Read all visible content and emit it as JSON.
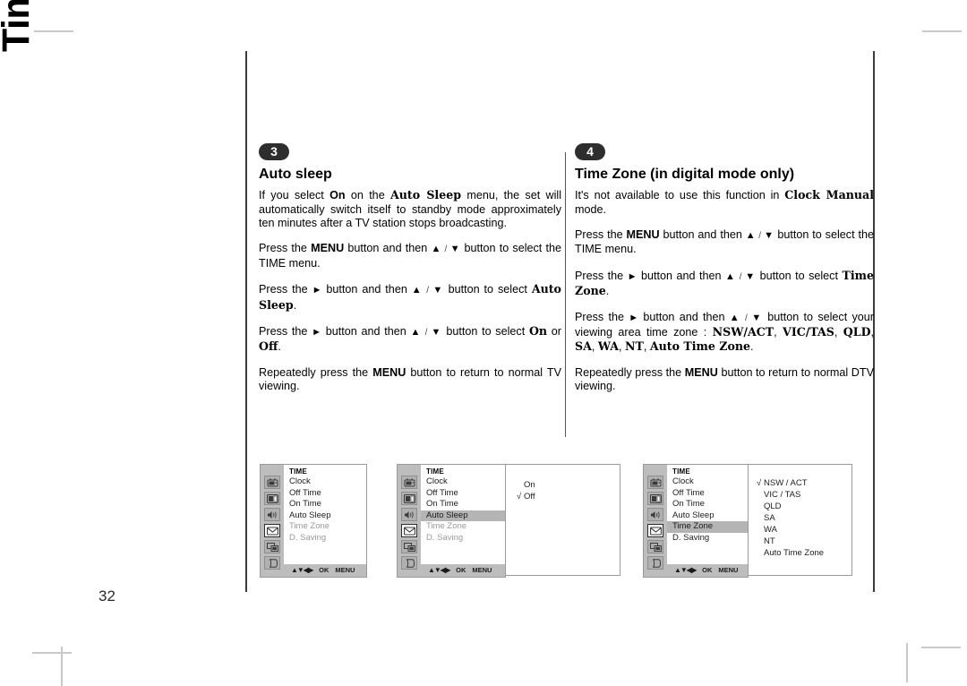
{
  "page": {
    "side_title": "Time Menu",
    "page_number": "32"
  },
  "sections": [
    {
      "badge": "3",
      "title": "Auto sleep",
      "paragraphs": [
        [
          {
            "t": "If you select ",
            "s": "n"
          },
          {
            "t": "On",
            "s": "b"
          },
          {
            "t": " on the ",
            "s": "n"
          },
          {
            "t": "Auto Sleep",
            "s": "slab"
          },
          {
            "t": " menu, the set will automatically switch itself to standby mode approximately ten minutes after a TV station stops broadcasting.",
            "s": "n"
          }
        ],
        [
          {
            "t": "Press the ",
            "s": "n"
          },
          {
            "t": "MENU",
            "s": "b"
          },
          {
            "t": " button and then ",
            "s": "n"
          },
          {
            "t": "▲",
            "s": "ar"
          },
          {
            "t": " / ",
            "s": "sl"
          },
          {
            "t": "▼",
            "s": "ar"
          },
          {
            "t": " button to select the TIME menu.",
            "s": "n"
          }
        ],
        [
          {
            "t": "Press the ",
            "s": "n"
          },
          {
            "t": "►",
            "s": "ar"
          },
          {
            "t": " button and then ",
            "s": "n"
          },
          {
            "t": "▲",
            "s": "ar"
          },
          {
            "t": " / ",
            "s": "sl"
          },
          {
            "t": "▼",
            "s": "ar"
          },
          {
            "t": " button to select ",
            "s": "n"
          },
          {
            "t": "Auto Sleep",
            "s": "slab"
          },
          {
            "t": ".",
            "s": "n"
          }
        ],
        [
          {
            "t": "Press the ",
            "s": "n"
          },
          {
            "t": "►",
            "s": "ar"
          },
          {
            "t": " button and then ",
            "s": "n"
          },
          {
            "t": "▲",
            "s": "ar"
          },
          {
            "t": " / ",
            "s": "sl"
          },
          {
            "t": "▼",
            "s": "ar"
          },
          {
            "t": " button to select ",
            "s": "n"
          },
          {
            "t": "On",
            "s": "slab"
          },
          {
            "t": " or ",
            "s": "n"
          },
          {
            "t": "Off",
            "s": "slab"
          },
          {
            "t": ".",
            "s": "n"
          }
        ],
        [
          {
            "t": "Repeatedly press the ",
            "s": "n"
          },
          {
            "t": "MENU",
            "s": "b"
          },
          {
            "t": " button to return to normal TV viewing.",
            "s": "n"
          }
        ]
      ]
    },
    {
      "badge": "4",
      "title": "Time Zone (in digital mode only)",
      "paragraphs": [
        [
          {
            "t": "It's not available to use this function in ",
            "s": "n"
          },
          {
            "t": "Clock Manual",
            "s": "slab"
          },
          {
            "t": " mode.",
            "s": "n"
          }
        ],
        [
          {
            "t": "Press the ",
            "s": "n"
          },
          {
            "t": "MENU",
            "s": "b"
          },
          {
            "t": " button and then ",
            "s": "n"
          },
          {
            "t": "▲",
            "s": "ar"
          },
          {
            "t": " / ",
            "s": "sl"
          },
          {
            "t": "▼",
            "s": "ar"
          },
          {
            "t": " button to select the TIME menu.",
            "s": "n"
          }
        ],
        [
          {
            "t": "Press the ",
            "s": "n"
          },
          {
            "t": "►",
            "s": "ar"
          },
          {
            "t": " button and then ",
            "s": "n"
          },
          {
            "t": "▲",
            "s": "ar"
          },
          {
            "t": " / ",
            "s": "sl"
          },
          {
            "t": "▼",
            "s": "ar"
          },
          {
            "t": " button to select ",
            "s": "n"
          },
          {
            "t": "Time Zone",
            "s": "slab"
          },
          {
            "t": ".",
            "s": "n"
          }
        ],
        [
          {
            "t": "Press the ",
            "s": "n"
          },
          {
            "t": "►",
            "s": "ar"
          },
          {
            "t": " button and then ",
            "s": "n"
          },
          {
            "t": "▲",
            "s": "ar"
          },
          {
            "t": " / ",
            "s": "sl"
          },
          {
            "t": "▼",
            "s": "ar"
          },
          {
            "t": " button to select your viewing area time zone : ",
            "s": "n"
          },
          {
            "t": "NSW/ACT",
            "s": "slab"
          },
          {
            "t": ", ",
            "s": "n"
          },
          {
            "t": "VIC/TAS",
            "s": "slab"
          },
          {
            "t": ", ",
            "s": "n"
          },
          {
            "t": "QLD",
            "s": "slab"
          },
          {
            "t": ", ",
            "s": "n"
          },
          {
            "t": "SA",
            "s": "slab"
          },
          {
            "t": ", ",
            "s": "n"
          },
          {
            "t": "WA",
            "s": "slab"
          },
          {
            "t": ", ",
            "s": "n"
          },
          {
            "t": "NT",
            "s": "slab"
          },
          {
            "t": ", ",
            "s": "n"
          },
          {
            "t": "Auto Time Zone",
            "s": "slab"
          },
          {
            "t": ".",
            "s": "n"
          }
        ],
        [
          {
            "t": "Repeatedly press the ",
            "s": "n"
          },
          {
            "t": "MENU",
            "s": "b"
          },
          {
            "t": " button to return to normal DTV viewing.",
            "s": "n"
          }
        ]
      ]
    }
  ],
  "osd": {
    "menu_title": "TIME",
    "icon_names": [
      "tv-icon",
      "screen-icon",
      "speaker-icon",
      "envelope-icon",
      "pip-icon",
      "page-icon"
    ],
    "footer": {
      "arrows": "▲▼◀▶",
      "ok": "OK",
      "menu": "MENU"
    },
    "panels": [
      {
        "id": "osd-panel-1",
        "items": [
          {
            "label": "Clock",
            "state": "normal"
          },
          {
            "label": "Off Time",
            "state": "normal"
          },
          {
            "label": "On Time",
            "state": "normal"
          },
          {
            "label": "Auto Sleep",
            "state": "normal"
          },
          {
            "label": "Time Zone",
            "state": "dim"
          },
          {
            "label": "D. Saving",
            "state": "dim"
          }
        ],
        "options": []
      },
      {
        "id": "osd-panel-2",
        "items": [
          {
            "label": "Clock",
            "state": "normal"
          },
          {
            "label": "Off Time",
            "state": "normal"
          },
          {
            "label": "On Time",
            "state": "normal"
          },
          {
            "label": "Auto Sleep",
            "state": "highlight"
          },
          {
            "label": "Time Zone",
            "state": "dim"
          },
          {
            "label": "D. Saving",
            "state": "dim"
          }
        ],
        "options": [
          {
            "label": "On",
            "checked": false
          },
          {
            "label": "Off",
            "checked": true
          }
        ]
      },
      {
        "id": "osd-panel-3",
        "items": [
          {
            "label": "Clock",
            "state": "normal"
          },
          {
            "label": "Off Time",
            "state": "normal"
          },
          {
            "label": "On Time",
            "state": "normal"
          },
          {
            "label": "Auto Sleep",
            "state": "normal"
          },
          {
            "label": "Time Zone",
            "state": "highlight"
          },
          {
            "label": "D. Saving",
            "state": "normal"
          }
        ],
        "options": [
          {
            "label": "NSW / ACT",
            "checked": true
          },
          {
            "label": "VIC / TAS",
            "checked": false
          },
          {
            "label": "QLD",
            "checked": false
          },
          {
            "label": "SA",
            "checked": false
          },
          {
            "label": "WA",
            "checked": false
          },
          {
            "label": "NT",
            "checked": false
          },
          {
            "label": "Auto Time Zone",
            "checked": false
          }
        ]
      }
    ]
  },
  "colors": {
    "osd_gray": "#bdbdbd",
    "osd_highlight": "#b4b4b4",
    "badge_bg": "#2e2e2e",
    "rule": "#3a3a3a"
  }
}
